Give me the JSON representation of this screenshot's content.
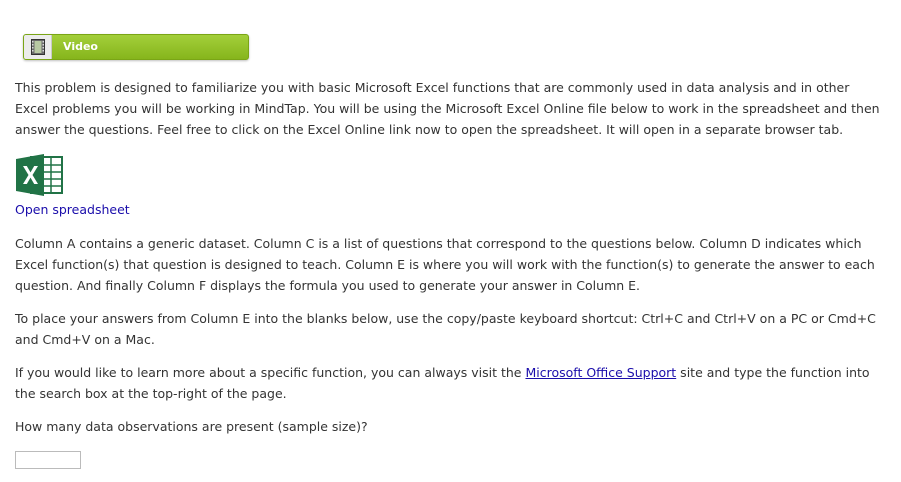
{
  "video_button": {
    "label": "Video",
    "icon": "film-icon"
  },
  "intro_text": "This problem is designed to familiarize you with basic Microsoft Excel functions that are commonly used in data analysis and in other Excel problems you will be working in MindTap. You will be using the Microsoft Excel Online file below to work in the spreadsheet and then answer the questions. Feel free to click on the Excel Online link now to open the spreadsheet. It will open in a separate browser tab.",
  "spreadsheet": {
    "icon": "excel-icon",
    "link_label": "Open spreadsheet"
  },
  "columns_text": "Column A contains a generic dataset. Column C is a list of questions that correspond to the questions below. Column D indicates which Excel function(s) that question is designed to teach. Column E is where you will work with the function(s) to generate the answer to each question. And finally Column F displays the formula you used to generate your answer in Column E.",
  "copy_paste_text": "To place your answers from Column E into the blanks below, use the copy/paste keyboard shortcut: Ctrl+C and Ctrl+V on a PC or Cmd+C and Cmd+V on a Mac.",
  "support": {
    "prefix": "If you would like to learn more about a specific function, you can always visit the ",
    "link_label": "Microsoft Office Support",
    "suffix": " site and type the function into the search box at the top-right of the page."
  },
  "question": {
    "text": "How many data observations are present (sample size)?",
    "answer_value": ""
  },
  "colors": {
    "video_green": "#96c22b",
    "excel_green": "#217346",
    "link_blue": "#1a0dab"
  }
}
